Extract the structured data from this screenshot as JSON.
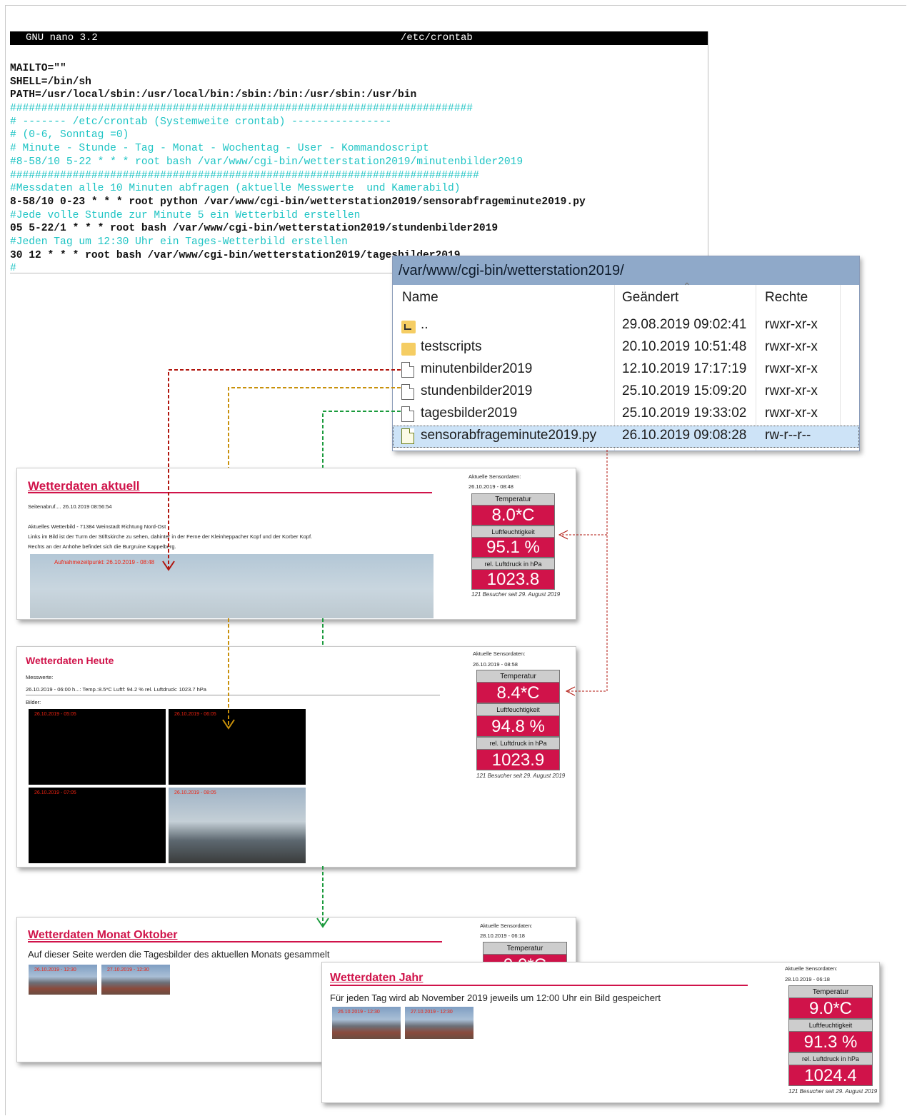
{
  "nano": {
    "version": "GNU nano 3.2",
    "filename": "/etc/crontab",
    "lines": [
      {
        "t": "MAILTO=\"\"",
        "k": "code"
      },
      {
        "t": "SHELL=/bin/sh",
        "k": "code"
      },
      {
        "t": "PATH=/usr/local/sbin:/usr/local/bin:/sbin:/bin:/usr/sbin:/usr/bin",
        "k": "code"
      },
      {
        "t": "##########################################################################",
        "k": "cmt"
      },
      {
        "t": "# ------- /etc/crontab (Systemweite crontab) ----------------",
        "k": "cmt"
      },
      {
        "t": "# (0-6, Sonntag =0)",
        "k": "cmt"
      },
      {
        "t": "# Minute - Stunde - Tag - Monat - Wochentag - User - Kommandoscript",
        "k": "cmt"
      },
      {
        "t": "#8-58/10 5-22 * * * root bash /var/www/cgi-bin/wetterstation2019/minutenbilder2019",
        "k": "cmt"
      },
      {
        "t": "###########################################################################",
        "k": "cmt"
      },
      {
        "t": "#Messdaten alle 10 Minuten abfragen (aktuelle Messwerte  und Kamerabild)",
        "k": "cmt"
      },
      {
        "t": "8-58/10 0-23 * * * root python /var/www/cgi-bin/wetterstation2019/sensorabfrageminute2019.py",
        "k": "code"
      },
      {
        "t": "#Jede volle Stunde zur Minute 5 ein Wetterbild erstellen",
        "k": "cmt"
      },
      {
        "t": "05 5-22/1 * * * root bash /var/www/cgi-bin/wetterstation2019/stundenbilder2019",
        "k": "code"
      },
      {
        "t": "#Jeden Tag um 12:30 Uhr ein Tages-Wetterbild erstellen",
        "k": "cmt"
      },
      {
        "t": "30 12 * * * root bash /var/www/cgi-bin/wetterstation2019/tagesbilder2019",
        "k": "code"
      },
      {
        "t": "#",
        "k": "cmt"
      }
    ]
  },
  "browser": {
    "path": "/var/www/cgi-bin/wetterstation2019/",
    "columns": {
      "name": "Name",
      "changed": "Geändert",
      "rights": "Rechte"
    },
    "rows": [
      {
        "name": "..",
        "changed": "29.08.2019 09:02:41",
        "rights": "rwxr-xr-x",
        "icon": "parent-folder-icon"
      },
      {
        "name": "testscripts",
        "changed": "20.10.2019 10:51:48",
        "rights": "rwxr-xr-x",
        "icon": "folder-icon"
      },
      {
        "name": "minutenbilder2019",
        "changed": "12.10.2019 17:17:19",
        "rights": "rwxr-xr-x",
        "icon": "file-icon"
      },
      {
        "name": "stundenbilder2019",
        "changed": "25.10.2019 15:09:20",
        "rights": "rwxr-xr-x",
        "icon": "file-icon"
      },
      {
        "name": "tagesbilder2019",
        "changed": "25.10.2019 19:33:02",
        "rights": "rwxr-xr-x",
        "icon": "file-icon"
      },
      {
        "name": "sensorabfrageminute2019.py",
        "changed": "26.10.2019 09:08:28",
        "rights": "rw-r--r--",
        "icon": "python-file-icon"
      }
    ]
  },
  "sensor_labels": {
    "heading": "Aktuelle Sensordaten:",
    "temp": "Temperatur",
    "humidity": "Luftfeuchtigkeit",
    "pressure": "rel. Luftdruck in hPa",
    "visitors": "121 Besucher seit 29. August 2019"
  },
  "aktuell": {
    "title": "Wetterdaten aktuell",
    "pagecall": "Seitenabruf.... 26.10.2019 08:56:54",
    "desc1": "Aktuelles Wetterbild - 71384 Weinstadt Richtung Nord-Ost",
    "desc2": "Links im Bild ist der Turm der Stiftskirche zu sehen, dahinter in der Ferne der Kleinheppacher Kopf und der Korber Kopf.",
    "desc3": "Rechts an der Anhöhe befindet sich die Burgruine Kappelberg.",
    "capture": "Aufnahmezeitpunkt: 26.10.2019 - 08:48",
    "sensor_date": "26.10.2019 - 08:48",
    "temp": "8.0*C",
    "humidity": "95.1 %",
    "pressure": "1023.8"
  },
  "heute": {
    "title": "Wetterdaten Heute",
    "messwerte": "Messwerte:",
    "reading": "26.10.2019 - 06:00 h...: Temp.:8.5*C Luftf: 94.2 % rel. Luftdruck: 1023.7 hPa",
    "bilder": "Bilder:",
    "thumbs": [
      "26.10.2019 - 05:05",
      "26.10.2019 - 06:05",
      "26.10.2019 - 07:05",
      "26.10.2019 - 08:05"
    ],
    "sensor_date": "26.10.2019 - 08:58",
    "temp": "8.4*C",
    "humidity": "94.8 %",
    "pressure": "1023.9"
  },
  "monat": {
    "title": "Wetterdaten Monat Oktober",
    "desc": "Auf dieser Seite werden die Tagesbilder des aktuellen Monats gesammelt",
    "thumbs": [
      "26.10.2019 - 12:30",
      "27.10.2019 - 12:30"
    ],
    "sensor_date": "28.10.2019 - 06:18",
    "temp_partial": "9.0*C"
  },
  "jahr": {
    "title": "Wetterdaten Jahr",
    "desc": "Für jeden Tag wird ab November 2019 jeweils um 12:00 Uhr ein Bild gespeichert",
    "thumbs": [
      "26.10.2019 - 12:30",
      "27.10.2019 - 12:30"
    ],
    "sensor_date": "28.10.2019 - 06:18",
    "temp": "9.0*C",
    "humidity": "91.3 %",
    "pressure": "1024.4"
  },
  "colors": {
    "accent": "#d0134a",
    "comment": "#1ec4c4",
    "arrow_red": "#b0140c",
    "arrow_orange": "#c8900a",
    "arrow_green": "#1a9a3c"
  }
}
